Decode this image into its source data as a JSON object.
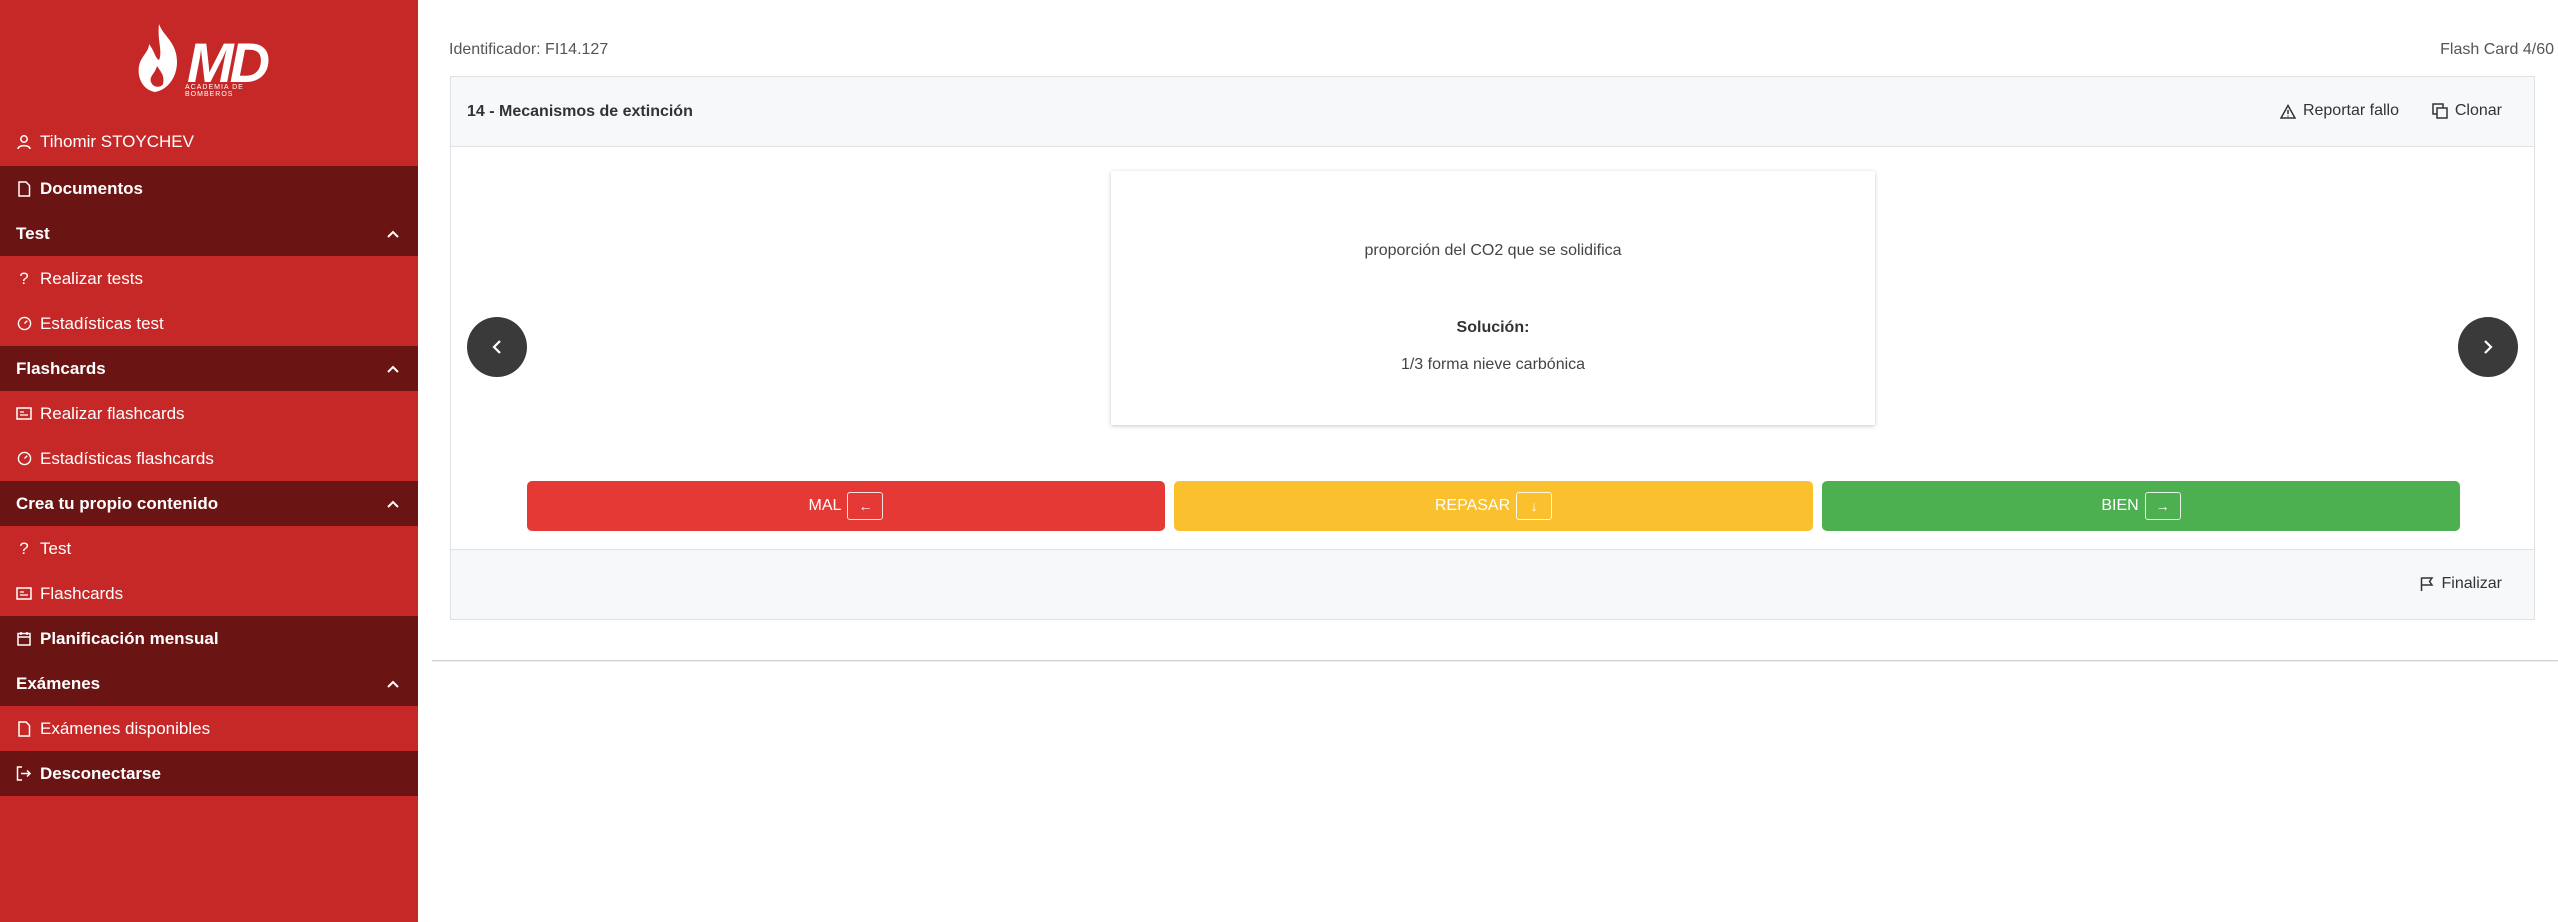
{
  "brand": {
    "logo_text": "MD",
    "logo_tagline": "ACADEMIA DE BOMBEROS"
  },
  "user": {
    "name": "Tihomir STOYCHEV"
  },
  "sidebar": {
    "documentos": "Documentos",
    "test_section": "Test",
    "realizar_tests": "Realizar tests",
    "estadisticas_test": "Estadísticas test",
    "flashcards_section": "Flashcards",
    "realizar_flashcards": "Realizar flashcards",
    "estadisticas_flashcards": "Estadísticas flashcards",
    "crea_section": "Crea tu propio contenido",
    "crea_test": "Test",
    "crea_flashcards": "Flashcards",
    "planificacion": "Planificación mensual",
    "examenes_section": "Exámenes",
    "examenes_disponibles": "Exámenes disponibles",
    "desconectarse": "Desconectarse"
  },
  "main": {
    "identifier": "Identificador: FI14.127",
    "counter": "Flash Card 4/60",
    "card_title": "14 - Mecanismos de extinción",
    "report_label": "Reportar fallo",
    "clone_label": "Clonar",
    "question": "proporción del CO2 que se solidifica",
    "solution_label": "Solución:",
    "answer": "1/3 forma nieve carbónica",
    "finish_label": "Finalizar"
  },
  "grades": {
    "bad_label": "MAL",
    "bad_key": "←",
    "review_label": "REPASAR",
    "review_key": "↓",
    "good_label": "BIEN",
    "good_key": "→"
  },
  "colors": {
    "sidebar": "#c62828",
    "sidebar_dark": "#6b1414",
    "bad": "#e53935",
    "review": "#fbc02d",
    "good": "#4caf50",
    "nav_button": "#3a3a3a"
  }
}
